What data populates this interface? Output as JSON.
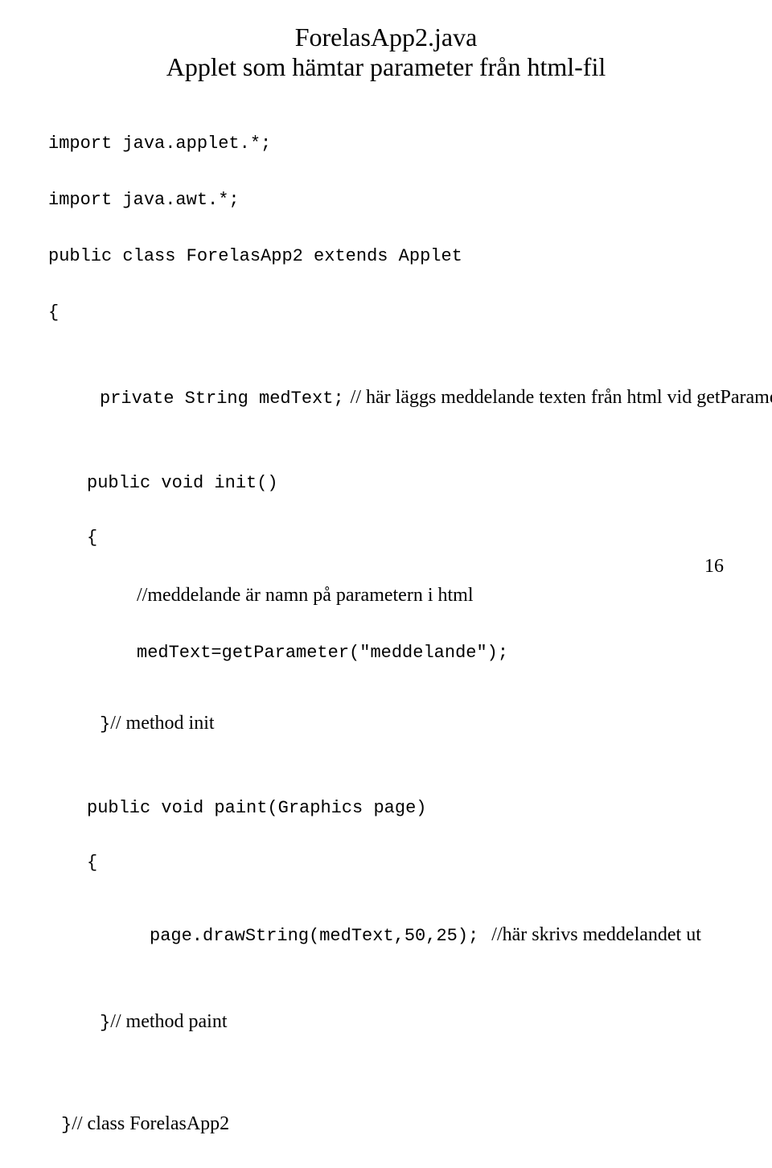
{
  "header": {
    "title": "ForelasApp2.java",
    "subtitle": "Applet som hämtar parameter från html-fil"
  },
  "code": {
    "import1": "import java.applet.*;",
    "import2": "import java.awt.*;",
    "classDecl": "public class ForelasApp2 extends Applet",
    "brace_open": "{",
    "private_pre": "private String medText;",
    "private_comment": "// här läggs meddelande texten från html vid getParameter",
    "init_decl": "public void init()",
    "brace_open2": "{",
    "init_comment": "//meddelande är namn på parametern i html",
    "init_body": "medText=getParameter(\"meddelande\");",
    "brace_close2": "}",
    "init_close_comment": "// method init",
    "paint_decl": "public void paint(Graphics page)",
    "brace_open3": "{",
    "paint_body": "page.drawString(medText,50,25);",
    "paint_comment": "//här skrivs meddelandet ut",
    "brace_close3": "}",
    "paint_close_comment": "// method paint",
    "brace_close1": "}",
    "class_close_comment": "// class ForelasApp2"
  },
  "page_number": "16"
}
